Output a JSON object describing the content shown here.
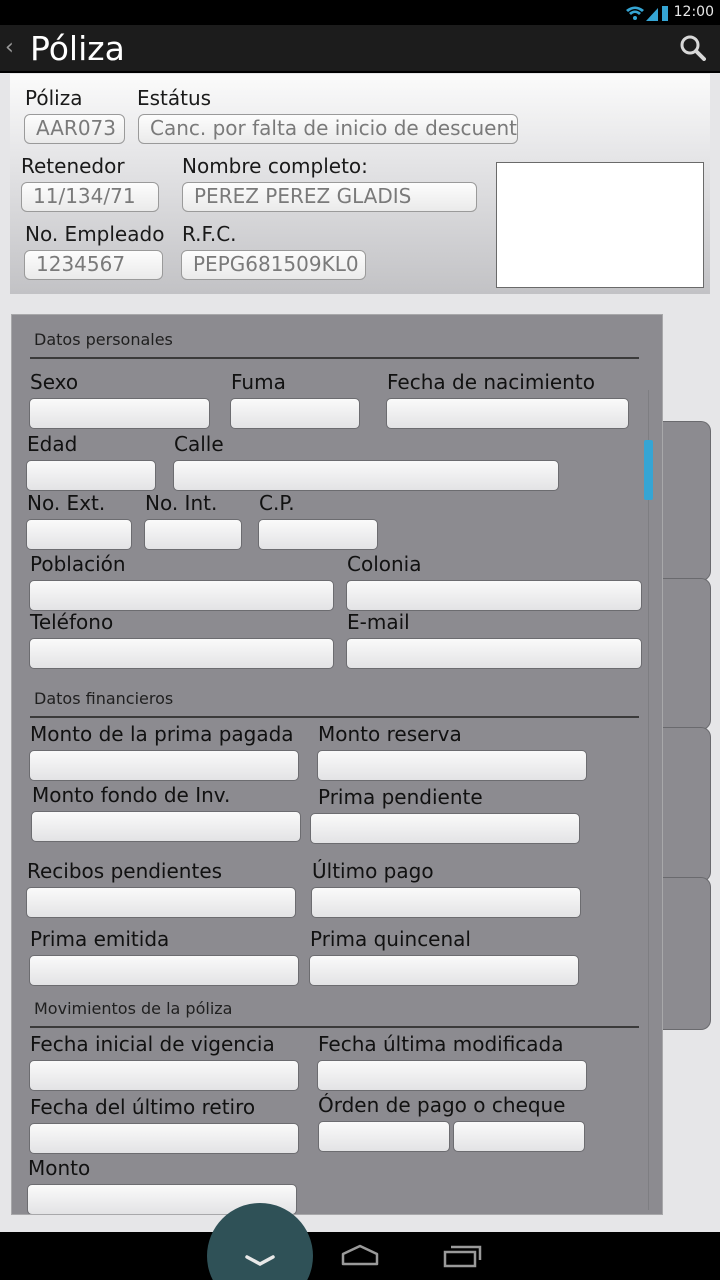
{
  "status_bar": {
    "time": "12:00",
    "icons": [
      "wifi-icon",
      "signal-icon",
      "battery-icon"
    ]
  },
  "action_bar": {
    "title": "Póliza",
    "back_icon": "chevron-left-icon",
    "search_icon": "search-icon"
  },
  "header": {
    "poliza": {
      "label": "Póliza",
      "value": "AAR073"
    },
    "estatus": {
      "label": "Estátus",
      "value": "Canc. por falta de inicio de descuento"
    },
    "retenedor": {
      "label": "Retenedor",
      "value": "11/134/71"
    },
    "nombre": {
      "label": "Nombre completo:",
      "value": "PEREZ PEREZ GLADIS"
    },
    "empleado": {
      "label": "No. Empleado",
      "value": "1234567"
    },
    "rfc": {
      "label": "R.F.C.",
      "value": "PEPG681509KL0"
    }
  },
  "personal": {
    "section_title": "Datos personales",
    "sexo": "Sexo",
    "fuma": "Fuma",
    "fecha_nacimiento": "Fecha de nacimiento",
    "edad": "Edad",
    "calle": "Calle",
    "no_ext": "No. Ext.",
    "no_int": "No. Int.",
    "cp": "C.P.",
    "poblacion": "Población",
    "colonia": "Colonia",
    "telefono": "Teléfono",
    "email": "E-mail"
  },
  "financial": {
    "section_title": "Datos financieros",
    "monto_prima_pagada": "Monto de la prima pagada",
    "monto_reserva": "Monto reserva",
    "monto_fondo": "Monto fondo de Inv.",
    "prima_pendiente": "Prima pendiente",
    "recibos_pendientes": "Recibos pendientes",
    "ultimo_pago": "Último pago",
    "prima_emitida": "Prima emitida",
    "prima_quincenal": "Prima quincenal"
  },
  "movements": {
    "section_title": "Movimientos de la póliza",
    "fecha_inicial": "Fecha inicial de vigencia",
    "fecha_ultima_mod": "Fecha última modificada",
    "fecha_ultimo_retiro": "Fecha del último retiro",
    "orden_pago": "Órden de pago o cheque",
    "monto": "Monto"
  },
  "colors": {
    "accent": "#35a5d4",
    "panel": "#8c8b90",
    "home": "#2f5157"
  }
}
